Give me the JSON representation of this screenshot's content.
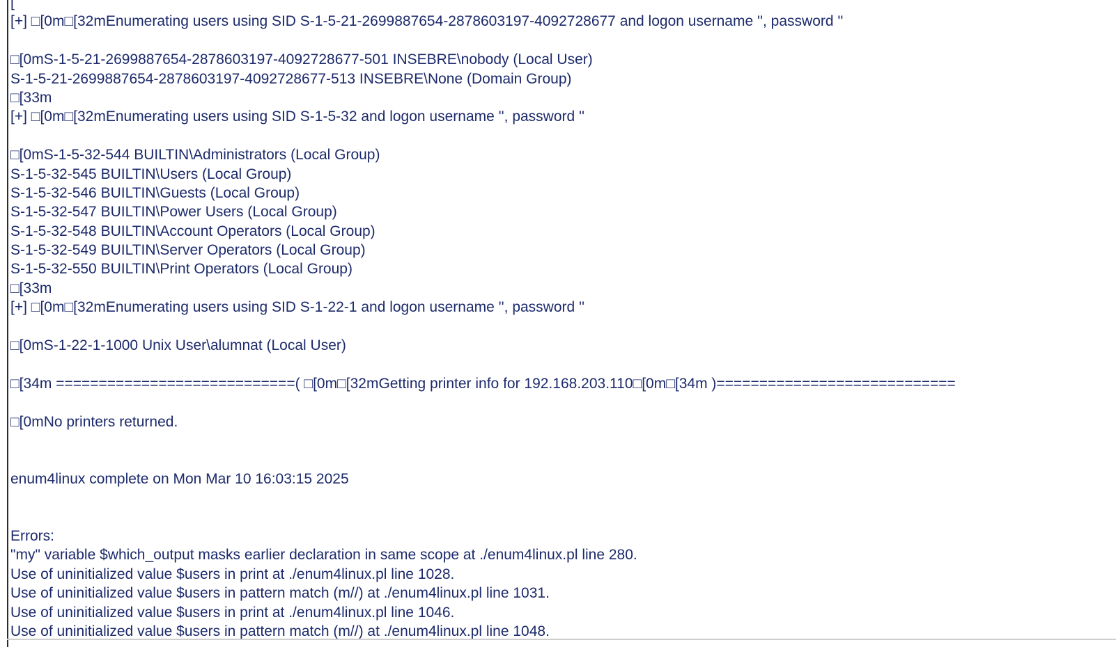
{
  "document": {
    "lines": [
      "[",
      "[+] □[0m□[32mEnumerating users using SID S-1-5-21-2699887654-2878603197-4092728677 and logon username '', password ''",
      "",
      "□[0mS-1-5-21-2699887654-2878603197-4092728677-501 INSEBRE\\nobody (Local User)",
      "S-1-5-21-2699887654-2878603197-4092728677-513 INSEBRE\\None (Domain Group)",
      "□[33m",
      "[+] □[0m□[32mEnumerating users using SID S-1-5-32 and logon username '', password ''",
      "",
      "□[0mS-1-5-32-544 BUILTIN\\Administrators (Local Group)",
      "S-1-5-32-545 BUILTIN\\Users (Local Group)",
      "S-1-5-32-546 BUILTIN\\Guests (Local Group)",
      "S-1-5-32-547 BUILTIN\\Power Users (Local Group)",
      "S-1-5-32-548 BUILTIN\\Account Operators (Local Group)",
      "S-1-5-32-549 BUILTIN\\Server Operators (Local Group)",
      "S-1-5-32-550 BUILTIN\\Print Operators (Local Group)",
      "□[33m",
      "[+] □[0m□[32mEnumerating users using SID S-1-22-1 and logon username '', password ''",
      "",
      "□[0mS-1-22-1-1000 Unix User\\alumnat (Local User)",
      "",
      "□[34m ============================( □[0m□[32mGetting printer info for 192.168.203.110□[0m□[34m )============================",
      "",
      "□[0mNo printers returned.",
      "",
      "",
      "enum4linux complete on Mon Mar 10 16:03:15 2025",
      "",
      "",
      "Errors:",
      "\"my\" variable $which_output masks earlier declaration in same scope at ./enum4linux.pl line 280.",
      "Use of uninitialized value $users in print at ./enum4linux.pl line 1028.",
      "Use of uninitialized value $users in pattern match (m//) at ./enum4linux.pl line 1031.",
      "Use of uninitialized value $users in print at ./enum4linux.pl line 1046.",
      "Use of uninitialized value $users in pattern match (m//) at ./enum4linux.pl line 1048."
    ]
  },
  "colors": {
    "text": "#1c2a6b",
    "background": "#ffffff",
    "left_rule": "#2b2b2b"
  }
}
